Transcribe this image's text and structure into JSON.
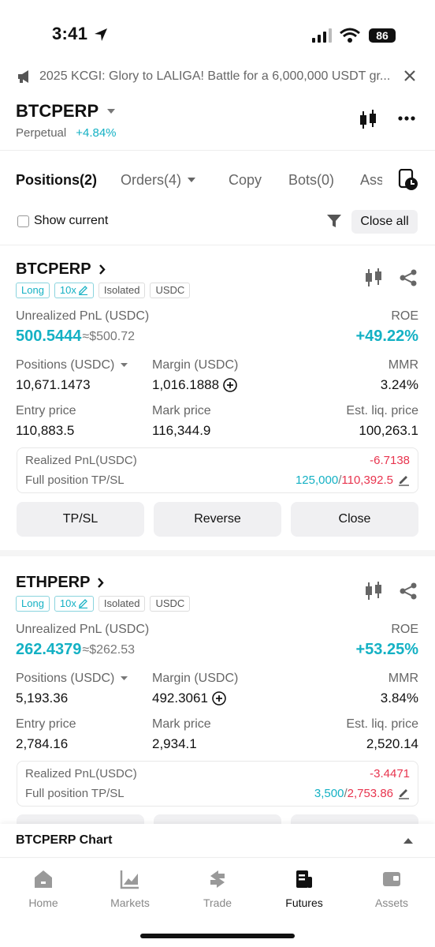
{
  "status": {
    "time": "3:41",
    "battery": "86"
  },
  "banner": {
    "text": "2025 KCGI: Glory to LALIGA!  Battle for a 6,000,000 USDT gr..."
  },
  "header": {
    "symbol": "BTCPERP",
    "type": "Perpetual",
    "change": "+4.84%"
  },
  "tabs": [
    {
      "label": "Positions(2)"
    },
    {
      "label": "Orders(4)"
    },
    {
      "label": "Copy"
    },
    {
      "label": "Bots(0)"
    },
    {
      "label": "Ass"
    }
  ],
  "filter": {
    "show_current": "Show current",
    "close_all": "Close all"
  },
  "positions": [
    {
      "symbol": "BTCPERP",
      "side": "Long",
      "leverage": "10x",
      "mode": "Isolated",
      "asset": "USDC",
      "upnl_label": "Unrealized PnL (USDC)",
      "upnl": "500.5444",
      "upnl_usd": "≈$500.72",
      "roe_label": "ROE",
      "roe": "+49.22%",
      "pos_label": "Positions (USDC)",
      "pos": "10,671.1473",
      "margin_label": "Margin (USDC)",
      "margin": "1,016.1888",
      "mmr_label": "MMR",
      "mmr": "3.24%",
      "entry_label": "Entry price",
      "entry": "110,883.5",
      "mark_label": "Mark price",
      "mark": "116,344.9",
      "liq_label": "Est. liq. price",
      "liq": "100,263.1",
      "rpnl_label": "Realized PnL(USDC)",
      "rpnl": "-6.7138",
      "tpsl_label": "Full position TP/SL",
      "tp": "125,000",
      "sl": "110,392.5",
      "btn_tpsl": "TP/SL",
      "btn_reverse": "Reverse",
      "btn_close": "Close"
    },
    {
      "symbol": "ETHPERP",
      "side": "Long",
      "leverage": "10x",
      "mode": "Isolated",
      "asset": "USDC",
      "upnl_label": "Unrealized PnL (USDC)",
      "upnl": "262.4379",
      "upnl_usd": "≈$262.53",
      "roe_label": "ROE",
      "roe": "+53.25%",
      "pos_label": "Positions (USDC)",
      "pos": "5,193.36",
      "margin_label": "Margin (USDC)",
      "margin": "492.3061",
      "mmr_label": "MMR",
      "mmr": "3.84%",
      "entry_label": "Entry price",
      "entry": "2,784.16",
      "mark_label": "Mark price",
      "mark": "2,934.1",
      "liq_label": "Est. liq. price",
      "liq": "2,520.14",
      "rpnl_label": "Realized PnL(USDC)",
      "rpnl": "-3.4471",
      "tpsl_label": "Full position TP/SL",
      "tp": "3,500",
      "sl": "2,753.86"
    }
  ],
  "chart_bar": {
    "label": "BTCPERP  Chart"
  },
  "nav": [
    {
      "label": "Home"
    },
    {
      "label": "Markets"
    },
    {
      "label": "Trade"
    },
    {
      "label": "Futures"
    },
    {
      "label": "Assets"
    }
  ],
  "colors": {
    "accent": "#14b1c4",
    "loss": "#e8344e",
    "liq": "#f0a630"
  }
}
